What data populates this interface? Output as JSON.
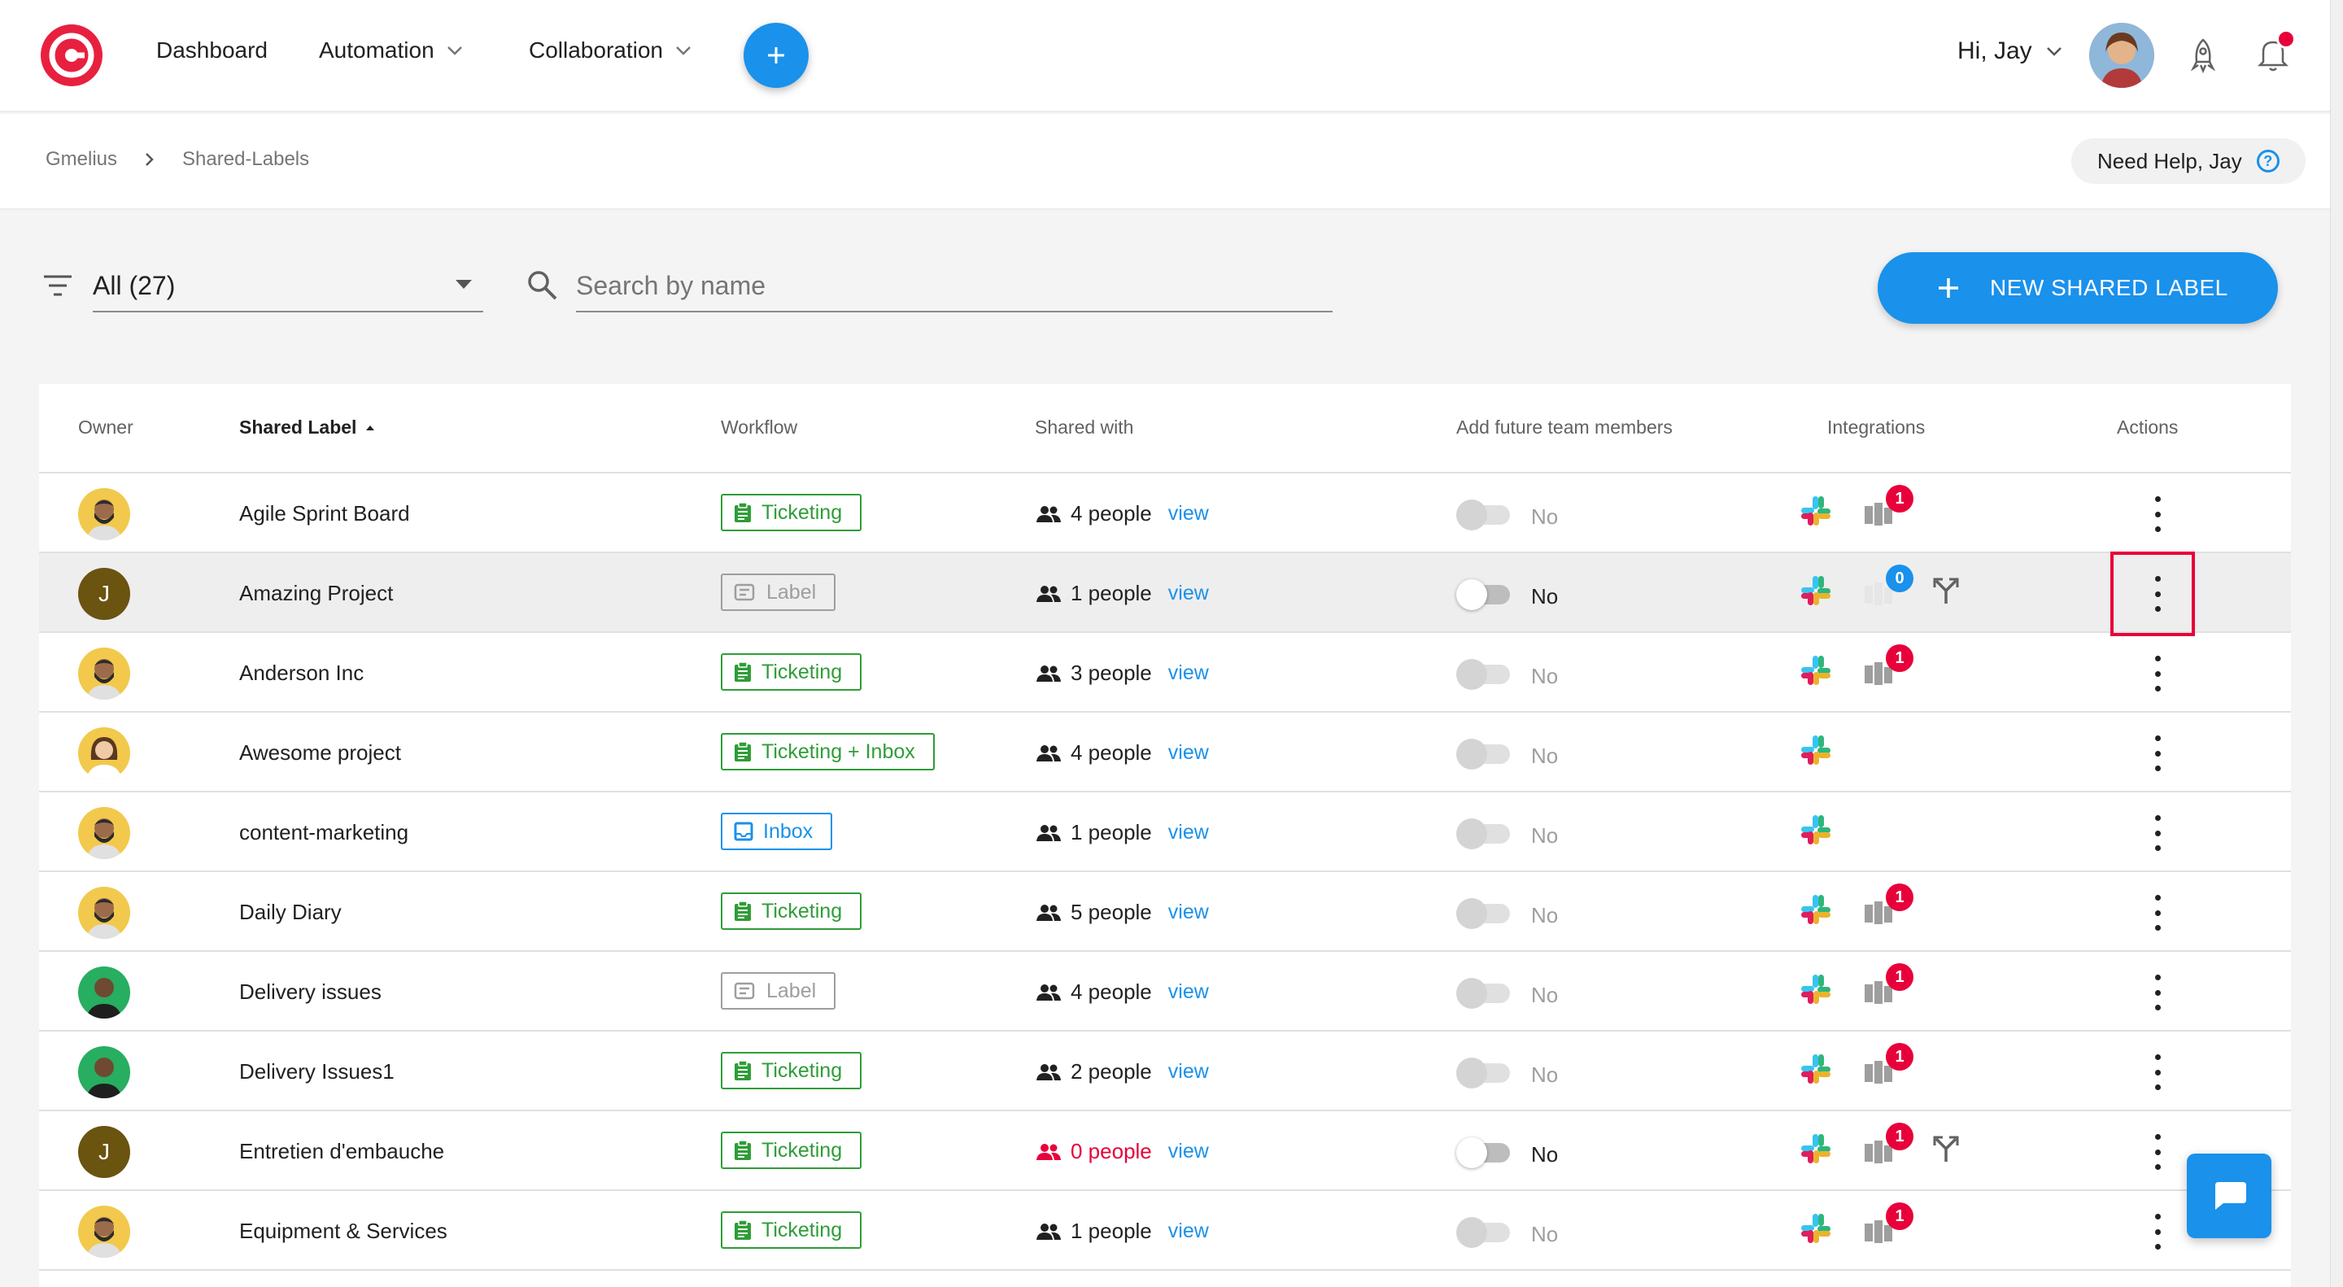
{
  "nav": {
    "items": [
      {
        "label": "Dashboard",
        "dropdown": false
      },
      {
        "label": "Automation",
        "dropdown": true
      },
      {
        "label": "Collaboration",
        "dropdown": true
      }
    ],
    "greeting": "Hi, Jay"
  },
  "breadcrumb": [
    "Gmelius",
    "Shared-Labels"
  ],
  "help_label": "Need Help, Jay",
  "filter": {
    "selected": "All (27)"
  },
  "search": {
    "placeholder": "Search by name"
  },
  "new_button_label": "NEW SHARED LABEL",
  "columns": [
    "Owner",
    "Shared Label",
    "Workflow",
    "Shared with",
    "Add future team members",
    "Integrations",
    "Actions"
  ],
  "view_label": "view",
  "rows": [
    {
      "name": "Agile Sprint Board",
      "owner": "photo-m1",
      "workflow": "Ticketing",
      "wf_style": "green",
      "people": "4 people",
      "toggle_on": false,
      "toggle_label": "No",
      "slack": true,
      "trello_badge": "1",
      "trello_badge_color": "red",
      "merge": false
    },
    {
      "name": "Amazing Project",
      "owner": "J",
      "workflow": "Label",
      "wf_style": "grey",
      "people": "1 people",
      "toggle_on": true,
      "toggle_label": "No",
      "slack": true,
      "trello_badge": "0",
      "trello_badge_color": "blue",
      "merge": true
    },
    {
      "name": "Anderson Inc",
      "owner": "photo-m1",
      "workflow": "Ticketing",
      "wf_style": "green",
      "people": "3 people",
      "toggle_on": false,
      "toggle_label": "No",
      "slack": true,
      "trello_badge": "1",
      "trello_badge_color": "red",
      "merge": false
    },
    {
      "name": "Awesome project",
      "owner": "photo-f1",
      "workflow": "Ticketing + Inbox",
      "wf_style": "green",
      "people": "4 people",
      "toggle_on": false,
      "toggle_label": "No",
      "slack": true,
      "trello_badge": "",
      "trello_badge_color": "",
      "merge": false
    },
    {
      "name": "content-marketing",
      "owner": "photo-m1",
      "workflow": "Inbox",
      "wf_style": "blue",
      "people": "1 people",
      "toggle_on": false,
      "toggle_label": "No",
      "slack": true,
      "trello_badge": "",
      "trello_badge_color": "",
      "merge": false
    },
    {
      "name": "Daily Diary",
      "owner": "photo-m1",
      "workflow": "Ticketing",
      "wf_style": "green",
      "people": "5 people",
      "toggle_on": false,
      "toggle_label": "No",
      "slack": true,
      "trello_badge": "1",
      "trello_badge_color": "red",
      "merge": false
    },
    {
      "name": "Delivery issues",
      "owner": "photo-m2",
      "workflow": "Label",
      "wf_style": "grey",
      "people": "4 people",
      "toggle_on": false,
      "toggle_label": "No",
      "slack": true,
      "trello_badge": "1",
      "trello_badge_color": "red",
      "merge": false
    },
    {
      "name": "Delivery Issues1",
      "owner": "photo-m2",
      "workflow": "Ticketing",
      "wf_style": "green",
      "people": "2 people",
      "toggle_on": false,
      "toggle_label": "No",
      "slack": true,
      "trello_badge": "1",
      "trello_badge_color": "red",
      "merge": false
    },
    {
      "name": "Entretien d'embauche",
      "owner": "J",
      "workflow": "Ticketing",
      "wf_style": "green",
      "people": "0 people",
      "people_alert": true,
      "toggle_on": true,
      "toggle_label": "No",
      "slack": true,
      "trello_badge": "1",
      "trello_badge_color": "red",
      "merge": true
    },
    {
      "name": "Equipment & Services",
      "owner": "photo-m1",
      "workflow": "Ticketing",
      "wf_style": "green",
      "people": "1 people",
      "toggle_on": false,
      "toggle_label": "No",
      "slack": true,
      "trello_badge": "1",
      "trello_badge_color": "red",
      "merge": false
    }
  ],
  "colors": {
    "accent": "#1a91eb",
    "brand": "#e8203f",
    "ticketing": "#2e9d37",
    "alert": "#e8003a"
  }
}
